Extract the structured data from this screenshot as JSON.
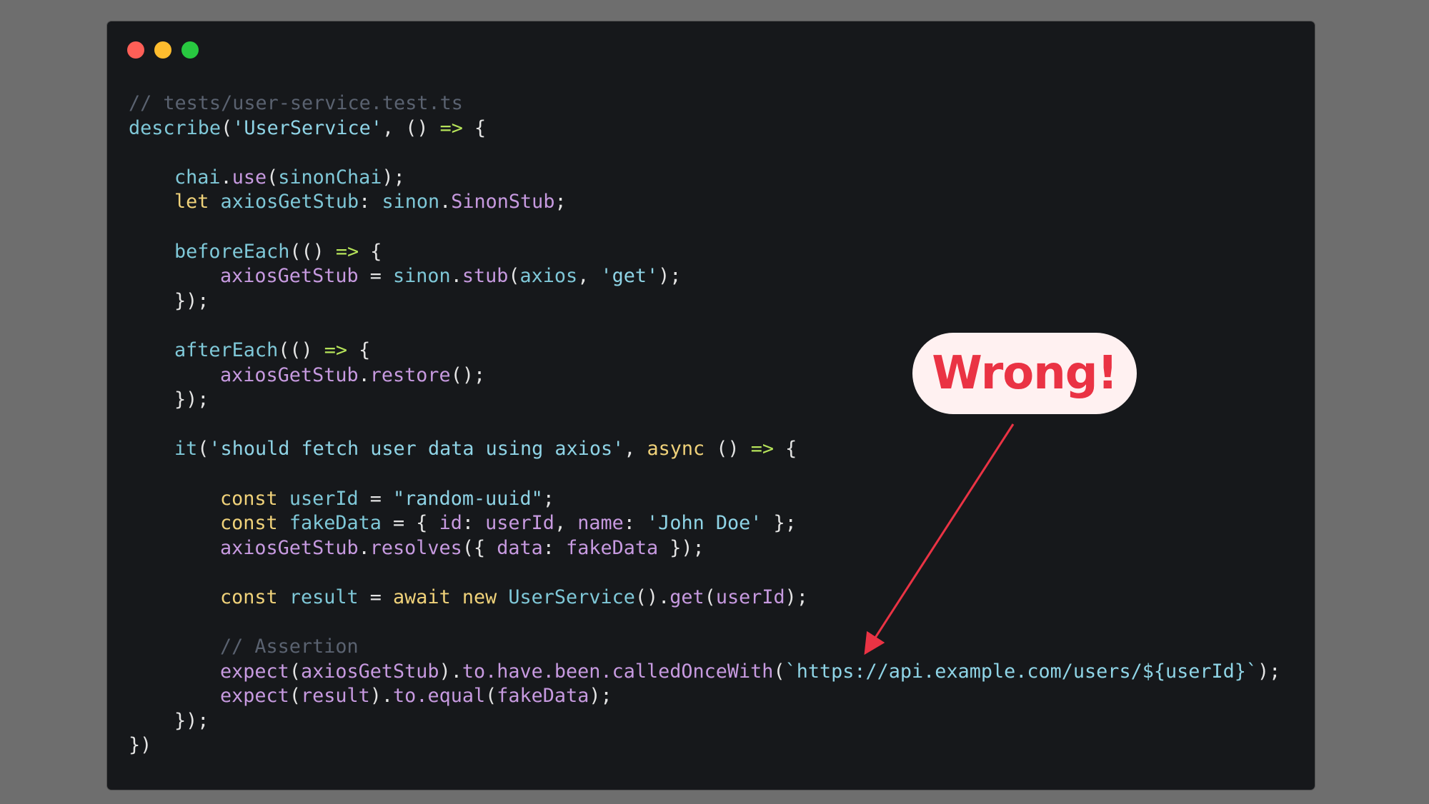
{
  "window": {
    "controls": {
      "close_color": "#fe5f57",
      "minimize_color": "#febc2e",
      "maximize_color": "#28c840"
    }
  },
  "code": {
    "l1": "// tests/user-service.test.ts",
    "l2": {
      "fn": "describe",
      "p1": "(",
      "str": "'UserService'",
      "p2": ", () ",
      "arrow": "=>",
      "p3": " {"
    },
    "l4": {
      "obj": "chai",
      "dot": ".",
      "method": "use",
      "p1": "(",
      "arg": "sinonChai",
      "p2": ");"
    },
    "l5": {
      "kw": "let",
      "var": "axiosGetStub",
      "p1": ": ",
      "ns": "sinon",
      "dot": ".",
      "type": "SinonStub",
      "p2": ";"
    },
    "l7": {
      "fn": "beforeEach",
      "p1": "(() ",
      "arrow": "=>",
      "p2": " {"
    },
    "l8": {
      "var": "axiosGetStub",
      "p1": " = ",
      "obj": "sinon",
      "dot": ".",
      "method": "stub",
      "p2": "(",
      "arg": "axios",
      "p3": ", ",
      "str": "'get'",
      "p4": ");"
    },
    "l9": "});",
    "l11": {
      "fn": "afterEach",
      "p1": "(() ",
      "arrow": "=>",
      "p2": " {"
    },
    "l12": {
      "var": "axiosGetStub",
      "dot": ".",
      "method": "restore",
      "p1": "();"
    },
    "l13": "});",
    "l15": {
      "fn": "it",
      "p1": "(",
      "str": "'should fetch user data using axios'",
      "p2": ", ",
      "kw": "async",
      "p3": " () ",
      "arrow": "=>",
      "p4": " {"
    },
    "l17": {
      "kw": "const",
      "var": "userId",
      "p1": " = ",
      "str": "\"random-uuid\"",
      "p2": ";"
    },
    "l18": {
      "kw": "const",
      "var": "fakeData",
      "p1": " = { ",
      "k1": "id",
      "p2": ": ",
      "v1": "userId",
      "p3": ", ",
      "k2": "name",
      "p4": ": ",
      "str": "'John Doe'",
      "p5": " };"
    },
    "l19": {
      "var": "axiosGetStub",
      "dot": ".",
      "method": "resolves",
      "p1": "({ ",
      "k1": "data",
      "p2": ": ",
      "v1": "fakeData",
      "p3": " });"
    },
    "l21": {
      "kw": "const",
      "var": "result",
      "p1": " = ",
      "kw2": "await",
      "kw3": "new",
      "cls": "UserService",
      "p2": "().",
      "method": "get",
      "p3": "(",
      "arg": "userId",
      "p4": ");"
    },
    "l23": "// Assertion",
    "l24": {
      "fn": "expect",
      "p1": "(",
      "arg": "axiosGetStub",
      "p2": ").",
      "chain": "to.have.been.calledOnceWith",
      "p3": "(",
      "str": "`https://api.example.com/users/${userId}`",
      "p4": ");"
    },
    "l25": {
      "fn": "expect",
      "p1": "(",
      "arg": "result",
      "p2": ").",
      "chain": "to.equal",
      "p3": "(",
      "arg2": "fakeData",
      "p4": ");"
    },
    "l26": "});",
    "l27": "})"
  },
  "callout": {
    "label": "Wrong!",
    "color": "#ea3344"
  }
}
